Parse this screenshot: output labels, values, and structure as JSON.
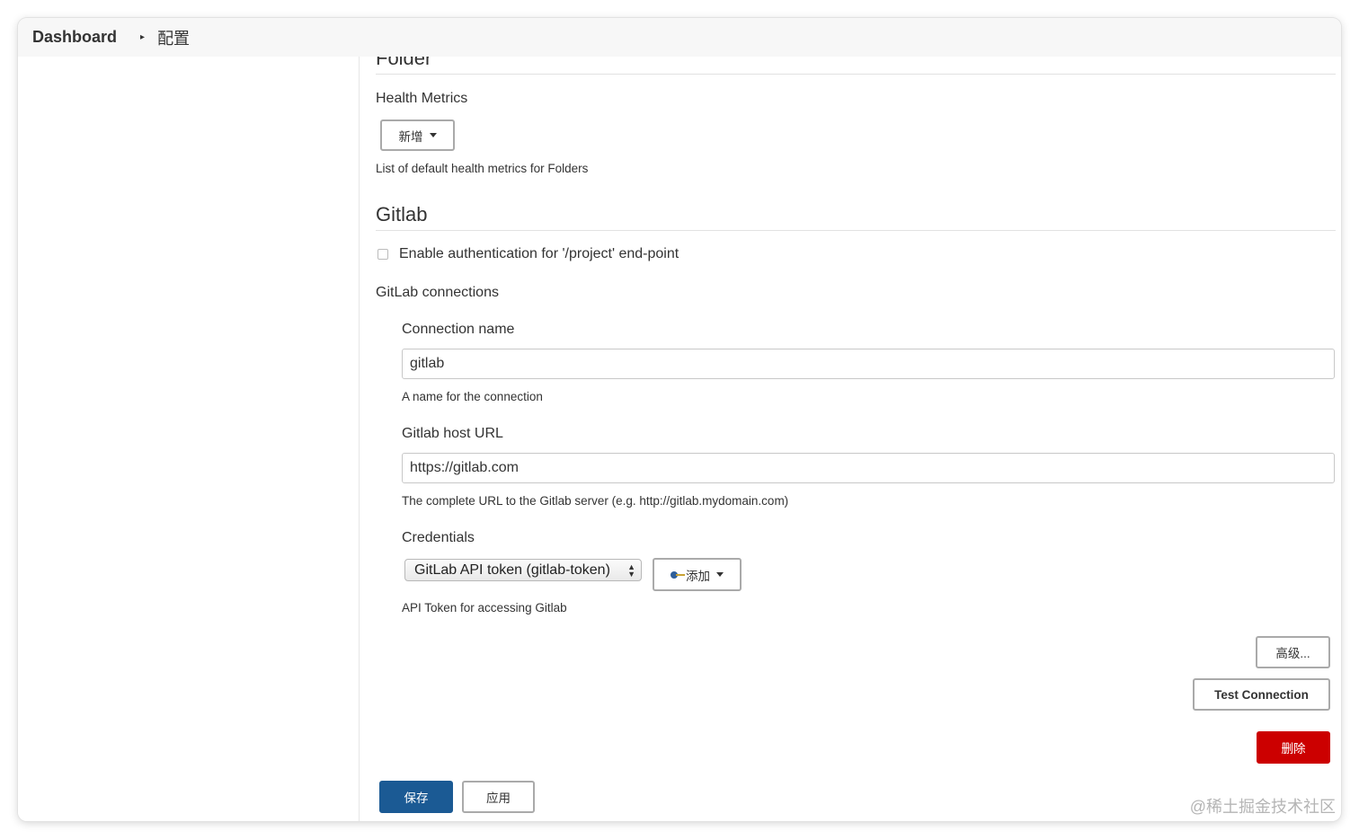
{
  "breadcrumb": {
    "home": "Dashboard",
    "separator": "▸",
    "current": "配置"
  },
  "folder": {
    "section_title": "Folder",
    "health_metrics_label": "Health Metrics",
    "add_button": "新增",
    "help": "List of default health metrics for Folders"
  },
  "gitlab": {
    "section_title": "Gitlab",
    "enable_auth_label": "Enable authentication for '/project' end-point",
    "enable_auth_checked": false,
    "connections_label": "GitLab connections",
    "connection_name_label": "Connection name",
    "connection_name_value": "gitlab",
    "connection_name_help": "A name for the connection",
    "host_url_label": "Gitlab host URL",
    "host_url_value": "https://gitlab.com",
    "host_url_help": "The complete URL to the Gitlab server (e.g. http://gitlab.mydomain.com)",
    "credentials_label": "Credentials",
    "credentials_selected": "GitLab API token (gitlab-token)",
    "credentials_add_button": "添加",
    "credentials_help": "API Token for accessing Gitlab",
    "advanced_button": "高级...",
    "test_connection_button": "Test Connection",
    "delete_button": "删除"
  },
  "footer": {
    "save_button": "保存",
    "apply_button": "应用"
  },
  "watermark": "@稀土掘金技术社区",
  "colors": {
    "primary": "#1b5a94",
    "danger": "#cc0000",
    "topbar_bg": "#f7f7f7"
  },
  "icons": {
    "add_credentials": "key-icon",
    "dropdown": "caret-down-icon",
    "breadcrumb_separator": "chevron-right-icon"
  }
}
